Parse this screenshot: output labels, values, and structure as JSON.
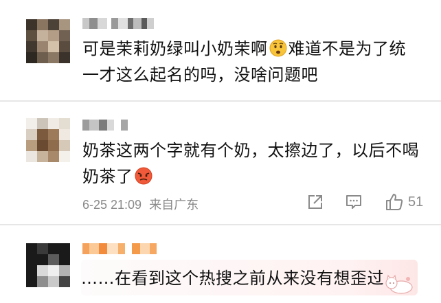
{
  "comments": [
    {
      "text": "可是茉莉奶绿叫小奶茉啊😧难道不是为了统一才这么起名的吗，没啥问题吧",
      "line1": "可是茉莉奶绿叫小奶茉啊",
      "line1b": "难道不是为了统",
      "line2": "一才这么起名的吗，没啥问题吧",
      "emoji": "anxious-face"
    },
    {
      "line1": "奶茶这两个字就有个奶，太擦边了，以后不喝",
      "line2": "奶茶了",
      "emoji": "angry-face",
      "date": "6-25 21:09",
      "location": "来自广东",
      "like_count": "51"
    },
    {
      "line1": "……在看到这个热搜之前从来没有想歪过",
      "sticker": "cat-sticker"
    }
  ],
  "colors": {
    "divider": "#e6e6e6",
    "meta_text": "#8a8a8a",
    "body_text": "#111111"
  }
}
